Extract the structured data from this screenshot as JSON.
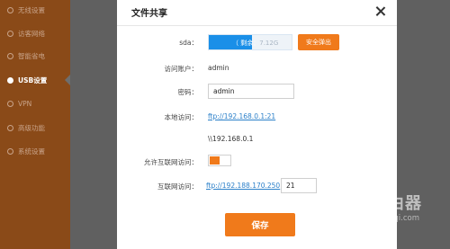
{
  "sidebar": {
    "items": [
      {
        "label": "无线设置",
        "active": false
      },
      {
        "label": "访客网络",
        "active": false
      },
      {
        "label": "智能省电",
        "active": false
      },
      {
        "label": "USB设置",
        "active": true
      },
      {
        "label": "VPN",
        "active": false
      },
      {
        "label": "高级功能",
        "active": false
      },
      {
        "label": "系统设置",
        "active": false
      }
    ]
  },
  "modal": {
    "title": "文件共享",
    "sda_label": "sda：",
    "storage": {
      "used_text": "（ 剩余：",
      "free_text": "7.12G",
      "used_fraction": 0.52
    },
    "eject_label": "安全弹出",
    "account_label": "访问账户：",
    "account_value": "admin",
    "password_label": "密码：",
    "password_value": "admin",
    "local_access_label": "本地访问：",
    "local_access_link": "ftp://192.168.0.1:21",
    "local_access_unc": "\\\\192.168.0.1",
    "allow_internet_label": "允许互联网访问：",
    "allow_internet_enabled": true,
    "internet_access_label": "互联网访问：",
    "internet_access_link": "ftp://192.188.170.250",
    "internet_port": "21",
    "save_label": "保存"
  },
  "watermark": {
    "cn": "路由器",
    "en": "luyouqi.com"
  }
}
